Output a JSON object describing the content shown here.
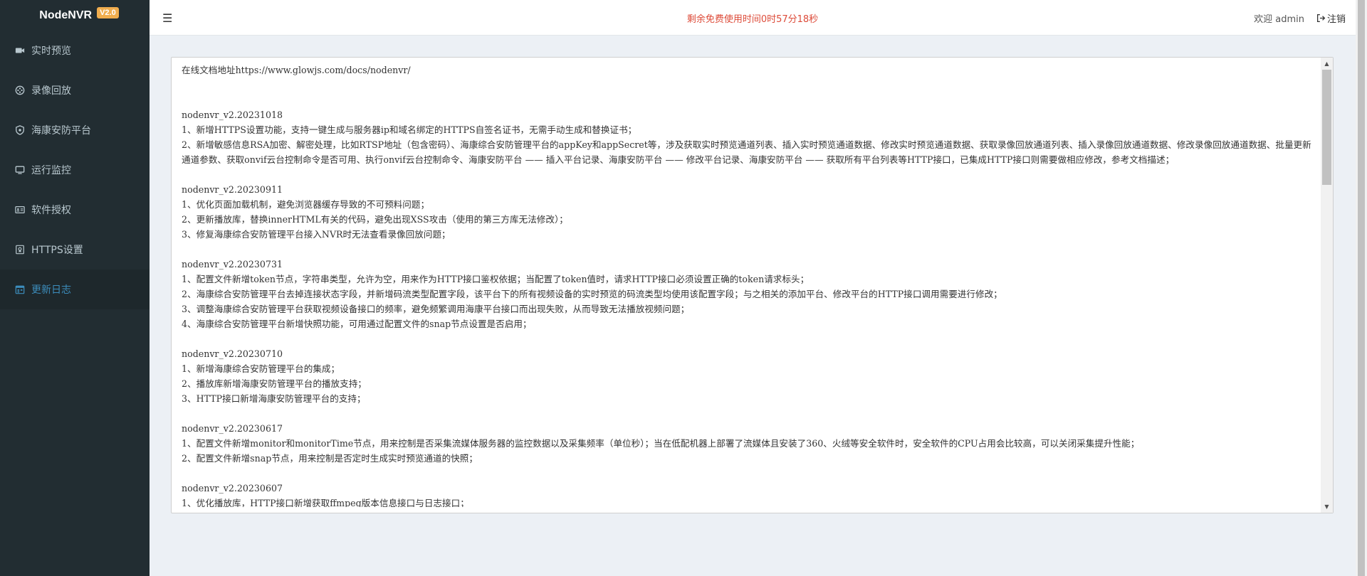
{
  "brand": {
    "name": "NodeNVR",
    "version": "V2.0"
  },
  "sidebar": {
    "items": [
      {
        "label": "实时预览",
        "icon": "video-camera-icon"
      },
      {
        "label": "录像回放",
        "icon": "film-reel-icon"
      },
      {
        "label": "海康安防平台",
        "icon": "shield-icon"
      },
      {
        "label": "运行监控",
        "icon": "monitor-icon"
      },
      {
        "label": "软件授权",
        "icon": "id-card-icon"
      },
      {
        "label": "HTTPS设置",
        "icon": "certificate-icon"
      },
      {
        "label": "更新日志",
        "icon": "calendar-log-icon",
        "active": true
      }
    ]
  },
  "header": {
    "timer_text": "剩余免费使用时间0时57分18秒",
    "welcome_text": "欢迎 admin",
    "logout_label": "注销"
  },
  "changelog": {
    "text": "在线文档地址https://www.glowjs.com/docs/nodenvr/\n\n\nnodenvr_v2.20231018\n1、新增HTTPS设置功能，支持一键生成与服务器ip和域名绑定的HTTPS自签名证书，无需手动生成和替换证书；\n2、新增敏感信息RSA加密、解密处理，比如RTSP地址（包含密码）、海康综合安防管理平台的appKey和appSecret等，涉及获取实时预览通道列表、插入实时预览通道数据、修改实时预览通道数据、获取录像回放通道列表、插入录像回放通道数据、修改录像回放通道数据、批量更新通道参数、获取onvif云台控制命令是否可用、执行onvif云台控制命令、海康安防平台 —— 插入平台记录、海康安防平台 —— 修改平台记录、海康安防平台 —— 获取所有平台列表等HTTP接口，已集成HTTP接口则需要做相应修改，参考文档描述；\n\nnodenvr_v2.20230911\n1、优化页面加载机制，避免浏览器缓存导致的不可预料问题；\n2、更新播放库，替换innerHTML有关的代码，避免出现XSS攻击（使用的第三方库无法修改）；\n3、修复海康综合安防管理平台接入NVR时无法查看录像回放问题；\n\nnodenvr_v2.20230731\n1、配置文件新增token节点，字符串类型，允许为空，用来作为HTTP接口鉴权依据；当配置了token值时，请求HTTP接口必须设置正确的token请求标头；\n2、海康综合安防管理平台去掉连接状态字段，并新增码流类型配置字段，该平台下的所有视频设备的实时预览的码流类型均使用该配置字段；与之相关的添加平台、修改平台的HTTP接口调用需要进行修改；\n3、调整海康综合安防管理平台获取视频设备接口的频率，避免频繁调用海康平台接口而出现失败，从而导致无法播放视频问题；\n4、海康综合安防管理平台新增快照功能，可用通过配置文件的snap节点设置是否启用；\n\nnodenvr_v2.20230710\n1、新增海康综合安防管理平台的集成；\n2、播放库新增海康安防管理平台的播放支持；\n3、HTTP接口新增海康安防管理平台的支持；\n\nnodenvr_v2.20230617\n1、配置文件新增monitor和monitorTime节点，用来控制是否采集流媒体服务器的监控数据以及采集频率（单位秒）；当在低配机器上部署了流媒体且安装了360、火绒等安全软件时，安全软件的CPU占用会比较高，可以关闭采集提升性能；\n2、配置文件新增snap节点，用来控制是否定时生成实时预览通道的快照；\n\nnodenvr_v2.20230607\n1、优化播放库，HTTP接口新增获取ffmpeg版本信息接口与日志接口；"
  },
  "colors": {
    "sidebar_bg": "#222d32",
    "active_item_bg": "#1e282c",
    "accent": "#3c8dbc",
    "timer_red": "#dd4b39",
    "version_badge": "#f0ad4e"
  }
}
